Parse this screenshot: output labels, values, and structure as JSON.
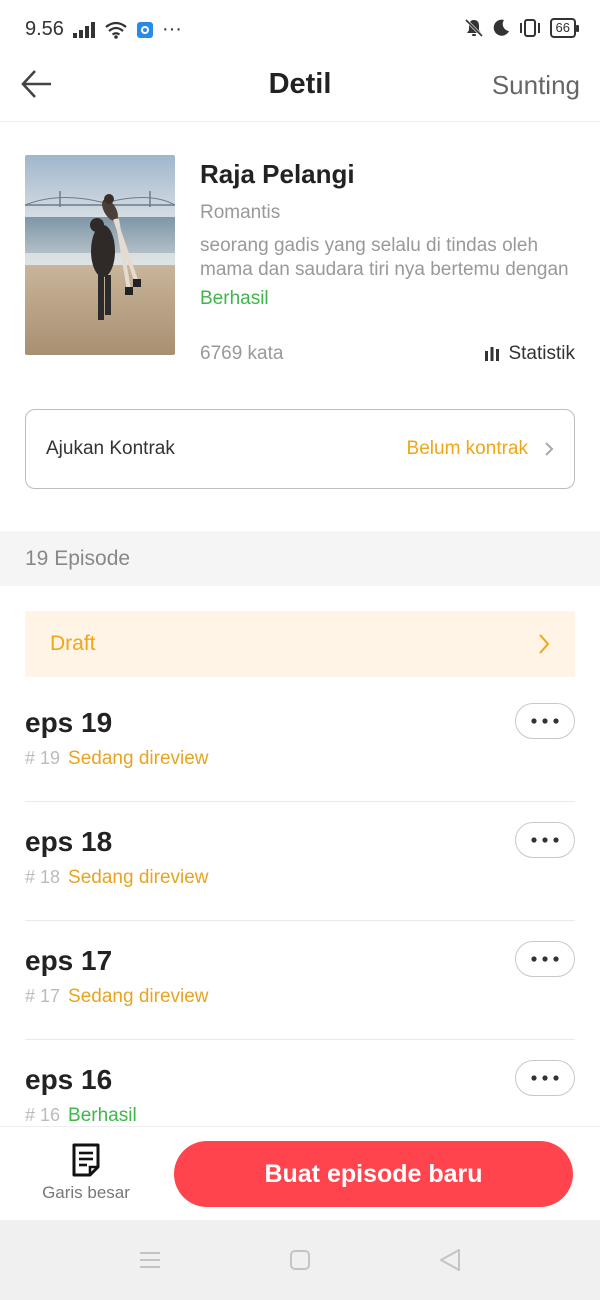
{
  "status_bar": {
    "time": "9.56",
    "battery": "66",
    "icons": [
      "signal-icon",
      "wifi-icon",
      "app-notification-icon",
      "more-dots-icon",
      "bell-off-icon",
      "moon-icon",
      "vibrate-icon",
      "battery-icon"
    ],
    "more": "···"
  },
  "header": {
    "title": "Detil",
    "edit_label": "Sunting"
  },
  "book": {
    "title": "Raja Pelangi",
    "genre": "Romantis",
    "description": "seorang gadis yang selalu di tindas oleh mama dan saudara tiri nya bertemu dengan",
    "status": "Berhasil",
    "word_count": "6769 kata",
    "stats_label": "Statistik"
  },
  "contract": {
    "label": "Ajukan Kontrak",
    "status": "Belum kontrak"
  },
  "episodes": {
    "header": "19 Episode",
    "draft_label": "Draft",
    "items": [
      {
        "title": "eps 19",
        "number": "# 19",
        "status": "Sedang direview"
      },
      {
        "title": "eps 18",
        "number": "# 18",
        "status": "Sedang direview"
      },
      {
        "title": "eps 17",
        "number": "# 17",
        "status": "Sedang direview"
      },
      {
        "title": "eps 16",
        "number": "# 16",
        "status": "Berhasil"
      }
    ]
  },
  "bottom": {
    "outline_label": "Garis besar",
    "create_label": "Buat episode baru"
  },
  "colors": {
    "accent_red": "#ff444d",
    "orange": "#f2a516",
    "green": "#3fb54a"
  }
}
